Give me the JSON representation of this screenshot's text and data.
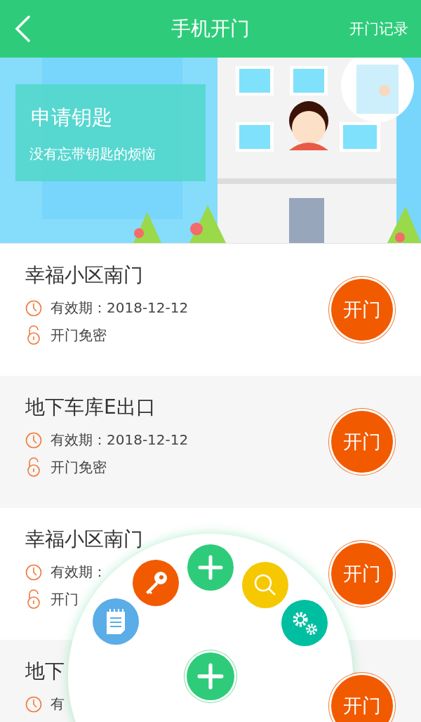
{
  "header": {
    "title": "手机开门",
    "action": "开门记录"
  },
  "banner": {
    "title": "申请钥匙",
    "subtitle": "没有忘带钥匙的烦恼"
  },
  "doors": [
    {
      "name": "幸福小区南门",
      "validity": "有效期：2018-12-12",
      "access": "开门免密",
      "button": "开门"
    },
    {
      "name": "地下车库E出口",
      "validity": "有效期：2018-12-12",
      "access": "开门免密",
      "button": "开门"
    },
    {
      "name": "幸福小区南门",
      "validity": "有效期：",
      "access": "开门",
      "button": "开门"
    },
    {
      "name": "地下",
      "validity": "有",
      "button": "开门"
    }
  ],
  "fab_menu": {
    "items": [
      {
        "kind": "notes",
        "color": "#5aade6"
      },
      {
        "kind": "key",
        "color": "#f25a00"
      },
      {
        "kind": "add",
        "color": "#2ecc7a"
      },
      {
        "kind": "search",
        "color": "#f5c800"
      },
      {
        "kind": "settings",
        "color": "#00bfa0"
      }
    ],
    "main": {
      "kind": "add",
      "color": "#2ecc7a"
    }
  }
}
